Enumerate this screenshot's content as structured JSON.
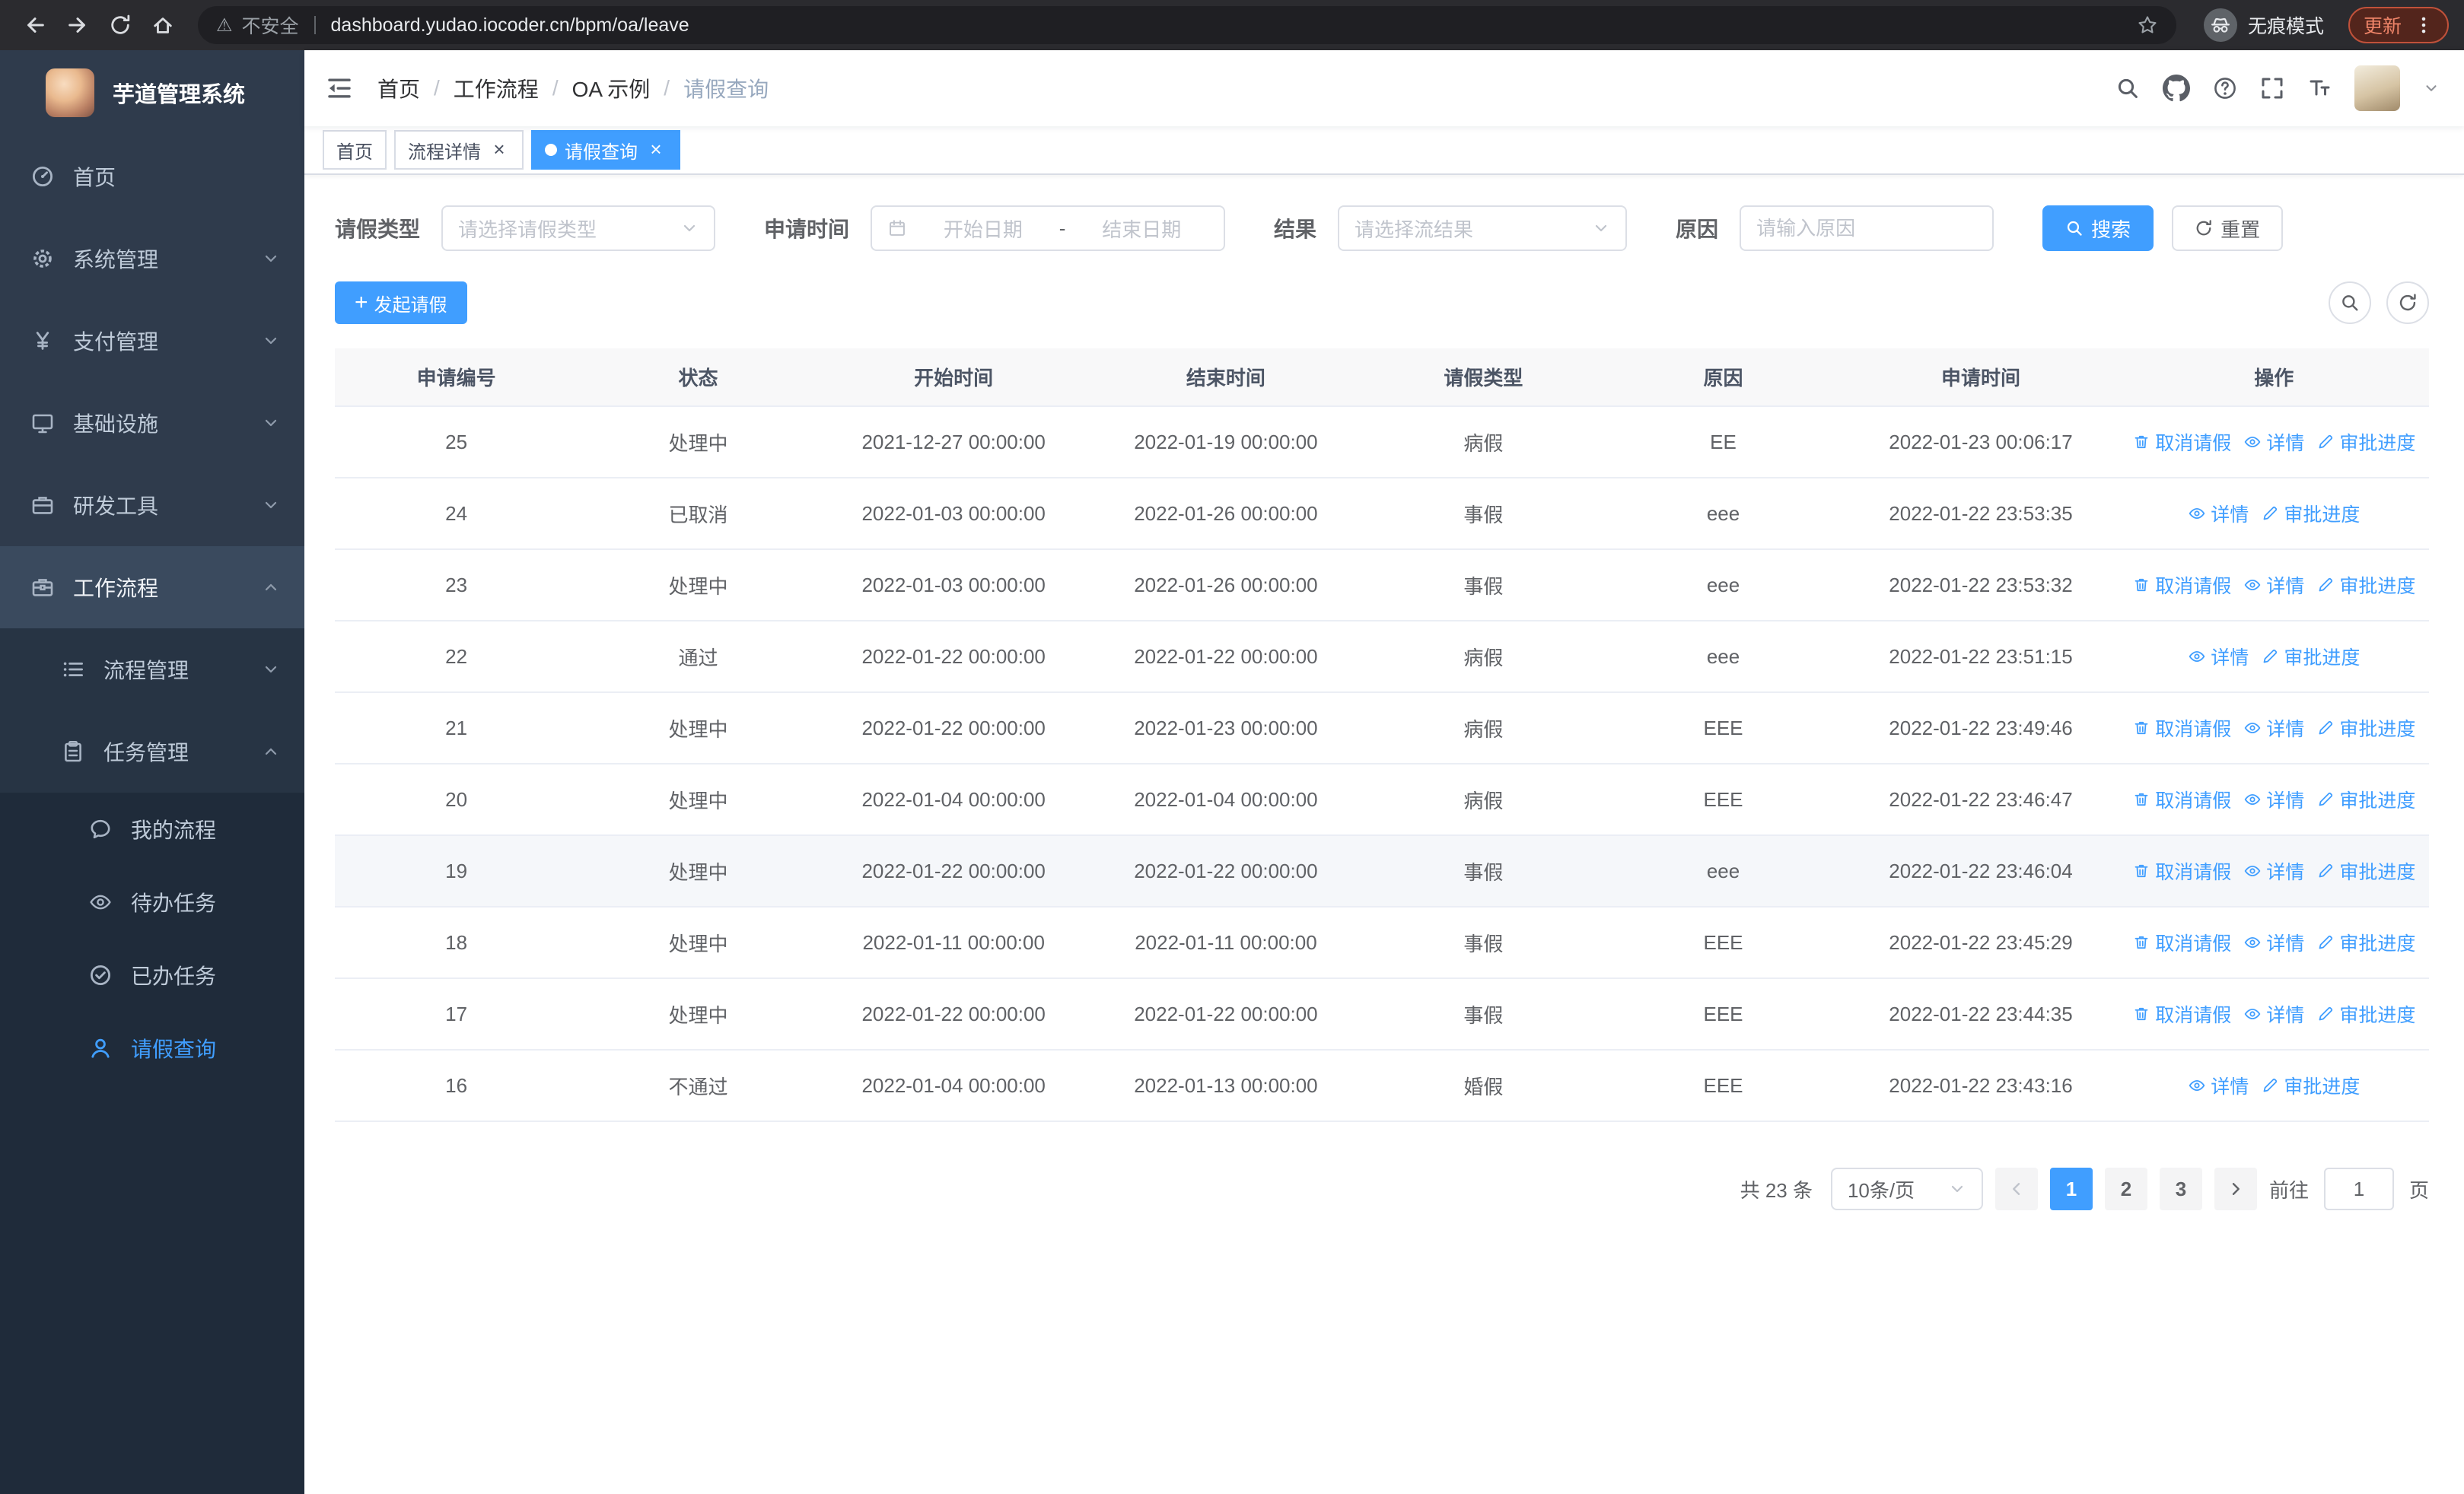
{
  "browser": {
    "security_label": "不安全",
    "url": "dashboard.yudao.iocoder.cn/bpm/oa/leave",
    "incognito_label": "无痕模式",
    "update_label": "更新"
  },
  "sidebar": {
    "logo_title": "芋道管理系统",
    "menu": {
      "home": "首页",
      "system": "系统管理",
      "payment": "支付管理",
      "infra": "基础设施",
      "devtools": "研发工具",
      "workflow": "工作流程",
      "process_mgmt": "流程管理",
      "task_mgmt": "任务管理",
      "my_process": "我的流程",
      "todo_tasks": "待办任务",
      "done_tasks": "已办任务",
      "leave_query": "请假查询"
    }
  },
  "header": {
    "breadcrumb": {
      "home": "首页",
      "workflow": "工作流程",
      "oa": "OA 示例",
      "current": "请假查询"
    }
  },
  "tabs": {
    "home": "首页",
    "process_detail": "流程详情",
    "leave_query": "请假查询"
  },
  "filter": {
    "leave_type_label": "请假类型",
    "leave_type_placeholder": "请选择请假类型",
    "apply_time_label": "申请时间",
    "date_start_placeholder": "开始日期",
    "date_separator": "-",
    "date_end_placeholder": "结束日期",
    "result_label": "结果",
    "result_placeholder": "请选择流结果",
    "reason_label": "原因",
    "reason_placeholder": "请输入原因",
    "search_button": "搜索",
    "reset_button": "重置"
  },
  "toolbar": {
    "create_button": "发起请假"
  },
  "table": {
    "columns": [
      "申请编号",
      "状态",
      "开始时间",
      "结束时间",
      "请假类型",
      "原因",
      "申请时间",
      "操作"
    ],
    "action_labels": {
      "cancel": "取消请假",
      "detail": "详情",
      "progress": "审批进度"
    },
    "rows": [
      {
        "id": "25",
        "status": "处理中",
        "start": "2021-12-27 00:00:00",
        "end": "2022-01-19 00:00:00",
        "type": "病假",
        "reason": "EE",
        "apply_time": "2022-01-23 00:06:17",
        "actions": [
          "cancel",
          "detail",
          "progress"
        ]
      },
      {
        "id": "24",
        "status": "已取消",
        "start": "2022-01-03 00:00:00",
        "end": "2022-01-26 00:00:00",
        "type": "事假",
        "reason": "eee",
        "apply_time": "2022-01-22 23:53:35",
        "actions": [
          "detail",
          "progress"
        ]
      },
      {
        "id": "23",
        "status": "处理中",
        "start": "2022-01-03 00:00:00",
        "end": "2022-01-26 00:00:00",
        "type": "事假",
        "reason": "eee",
        "apply_time": "2022-01-22 23:53:32",
        "actions": [
          "cancel",
          "detail",
          "progress"
        ]
      },
      {
        "id": "22",
        "status": "通过",
        "start": "2022-01-22 00:00:00",
        "end": "2022-01-22 00:00:00",
        "type": "病假",
        "reason": "eee",
        "apply_time": "2022-01-22 23:51:15",
        "actions": [
          "detail",
          "progress"
        ]
      },
      {
        "id": "21",
        "status": "处理中",
        "start": "2022-01-22 00:00:00",
        "end": "2022-01-23 00:00:00",
        "type": "病假",
        "reason": "EEE",
        "apply_time": "2022-01-22 23:49:46",
        "actions": [
          "cancel",
          "detail",
          "progress"
        ]
      },
      {
        "id": "20",
        "status": "处理中",
        "start": "2022-01-04 00:00:00",
        "end": "2022-01-04 00:00:00",
        "type": "病假",
        "reason": "EEE",
        "apply_time": "2022-01-22 23:46:47",
        "actions": [
          "cancel",
          "detail",
          "progress"
        ]
      },
      {
        "id": "19",
        "status": "处理中",
        "start": "2022-01-22 00:00:00",
        "end": "2022-01-22 00:00:00",
        "type": "事假",
        "reason": "eee",
        "apply_time": "2022-01-22 23:46:04",
        "actions": [
          "cancel",
          "detail",
          "progress"
        ],
        "highlighted": true
      },
      {
        "id": "18",
        "status": "处理中",
        "start": "2022-01-11 00:00:00",
        "end": "2022-01-11 00:00:00",
        "type": "事假",
        "reason": "EEE",
        "apply_time": "2022-01-22 23:45:29",
        "actions": [
          "cancel",
          "detail",
          "progress"
        ]
      },
      {
        "id": "17",
        "status": "处理中",
        "start": "2022-01-22 00:00:00",
        "end": "2022-01-22 00:00:00",
        "type": "事假",
        "reason": "EEE",
        "apply_time": "2022-01-22 23:44:35",
        "actions": [
          "cancel",
          "detail",
          "progress"
        ]
      },
      {
        "id": "16",
        "status": "不通过",
        "start": "2022-01-04 00:00:00",
        "end": "2022-01-13 00:00:00",
        "type": "婚假",
        "reason": "EEE",
        "apply_time": "2022-01-22 23:43:16",
        "actions": [
          "detail",
          "progress"
        ]
      }
    ]
  },
  "pagination": {
    "total_text": "共 23 条",
    "page_size": "10条/页",
    "pages": [
      "1",
      "2",
      "3"
    ],
    "current": "1",
    "goto_prefix": "前往",
    "goto_value": "1",
    "goto_suffix": "页"
  },
  "colors": {
    "primary": "#409EFF",
    "sidebar_bg": "#2f3b4c",
    "sidebar_submenu_bg": "#1f2b3a",
    "table_header_bg": "#f8f8f9"
  }
}
